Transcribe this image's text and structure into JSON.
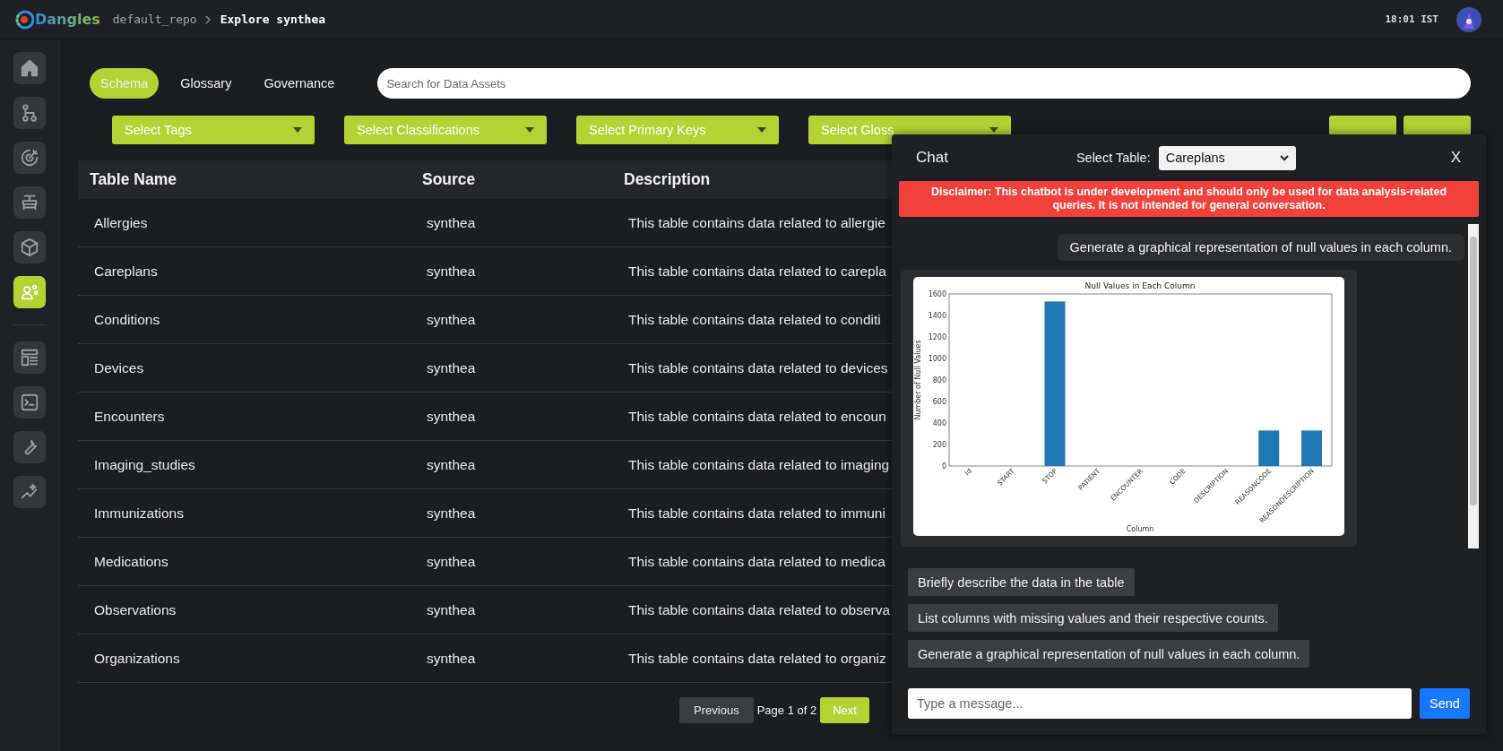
{
  "header": {
    "logo": "Dangles",
    "repo": "default_repo",
    "page": "Explore synthea",
    "time": "18:01 IST"
  },
  "sidebar": {
    "items": [
      {
        "selected": false
      },
      {
        "selected": false
      },
      {
        "selected": false
      },
      {
        "selected": false
      },
      {
        "selected": false
      },
      {
        "selected": true
      },
      {
        "selected": false
      },
      {
        "selected": false
      },
      {
        "selected": false
      },
      {
        "selected": false
      }
    ]
  },
  "tabs": [
    {
      "label": "Schema",
      "selected": true
    },
    {
      "label": "Glossary",
      "selected": false
    },
    {
      "label": "Governance",
      "selected": false
    }
  ],
  "search": {
    "placeholder": "Search for Data Assets"
  },
  "filters": [
    {
      "label": "Select Tags"
    },
    {
      "label": "Select Classifications"
    },
    {
      "label": "Select Primary Keys"
    },
    {
      "label": "Select Gloss"
    }
  ],
  "table": {
    "columns": [
      "Table Name",
      "Source",
      "Description"
    ],
    "rows": [
      {
        "name": "Allergies",
        "source": "synthea",
        "description": "This table contains data related to allergie"
      },
      {
        "name": "Careplans",
        "source": "synthea",
        "description": "This table contains data related to carepla"
      },
      {
        "name": "Conditions",
        "source": "synthea",
        "description": "This table contains data related to conditi"
      },
      {
        "name": "Devices",
        "source": "synthea",
        "description": "This table contains data related to devices"
      },
      {
        "name": "Encounters",
        "source": "synthea",
        "description": "This table contains data related to encoun"
      },
      {
        "name": "Imaging_studies",
        "source": "synthea",
        "description": "This table contains data related to imaging"
      },
      {
        "name": "Immunizations",
        "source": "synthea",
        "description": "This table contains data related to immuni"
      },
      {
        "name": "Medications",
        "source": "synthea",
        "description": "This table contains data related to medica"
      },
      {
        "name": "Observations",
        "source": "synthea",
        "description": "This table contains data related to observa"
      },
      {
        "name": "Organizations",
        "source": "synthea",
        "description": "This table contains data related to organiz"
      }
    ]
  },
  "pagination": {
    "previous": "Previous",
    "page": "Page 1 of 2",
    "next": "Next"
  },
  "chat": {
    "title": "Chat",
    "select_label": "Select Table:",
    "select_value": "Careplans",
    "close": "X",
    "disclaimer": "Disclaimer: This chatbot is under development and should only be used for data analysis-related queries. It is not intended for general conversation.",
    "messages": [
      {
        "kind": "user",
        "text": "Generate a graphical representation of null values in each column."
      },
      {
        "kind": "chart",
        "chart_data": {
          "type": "bar",
          "title": "Null Values in Each Column",
          "xlabel": "Column",
          "ylabel": "Number of Null Values",
          "categories": [
            "Id",
            "START",
            "STOP",
            "PATIENT",
            "ENCOUNTER",
            "CODE",
            "DESCRIPTION",
            "REASONCODE",
            "REASONDESCRIPTION"
          ],
          "series": [
            {
              "color": "#1f77b4",
              "values": [
                0,
                0,
                1530,
                0,
                0,
                0,
                0,
                330,
                330
              ]
            }
          ],
          "ylim": [
            0,
            1600
          ],
          "yticks": [
            0,
            200,
            400,
            600,
            800,
            1000,
            1200,
            1400,
            1600
          ]
        }
      }
    ],
    "suggestions": [
      "Briefly describe the data in the table",
      "List columns with missing values and their respective counts.",
      "Generate a graphical representation of null values in each column."
    ],
    "input": {
      "placeholder": "Type a message..."
    },
    "send": "Send"
  }
}
